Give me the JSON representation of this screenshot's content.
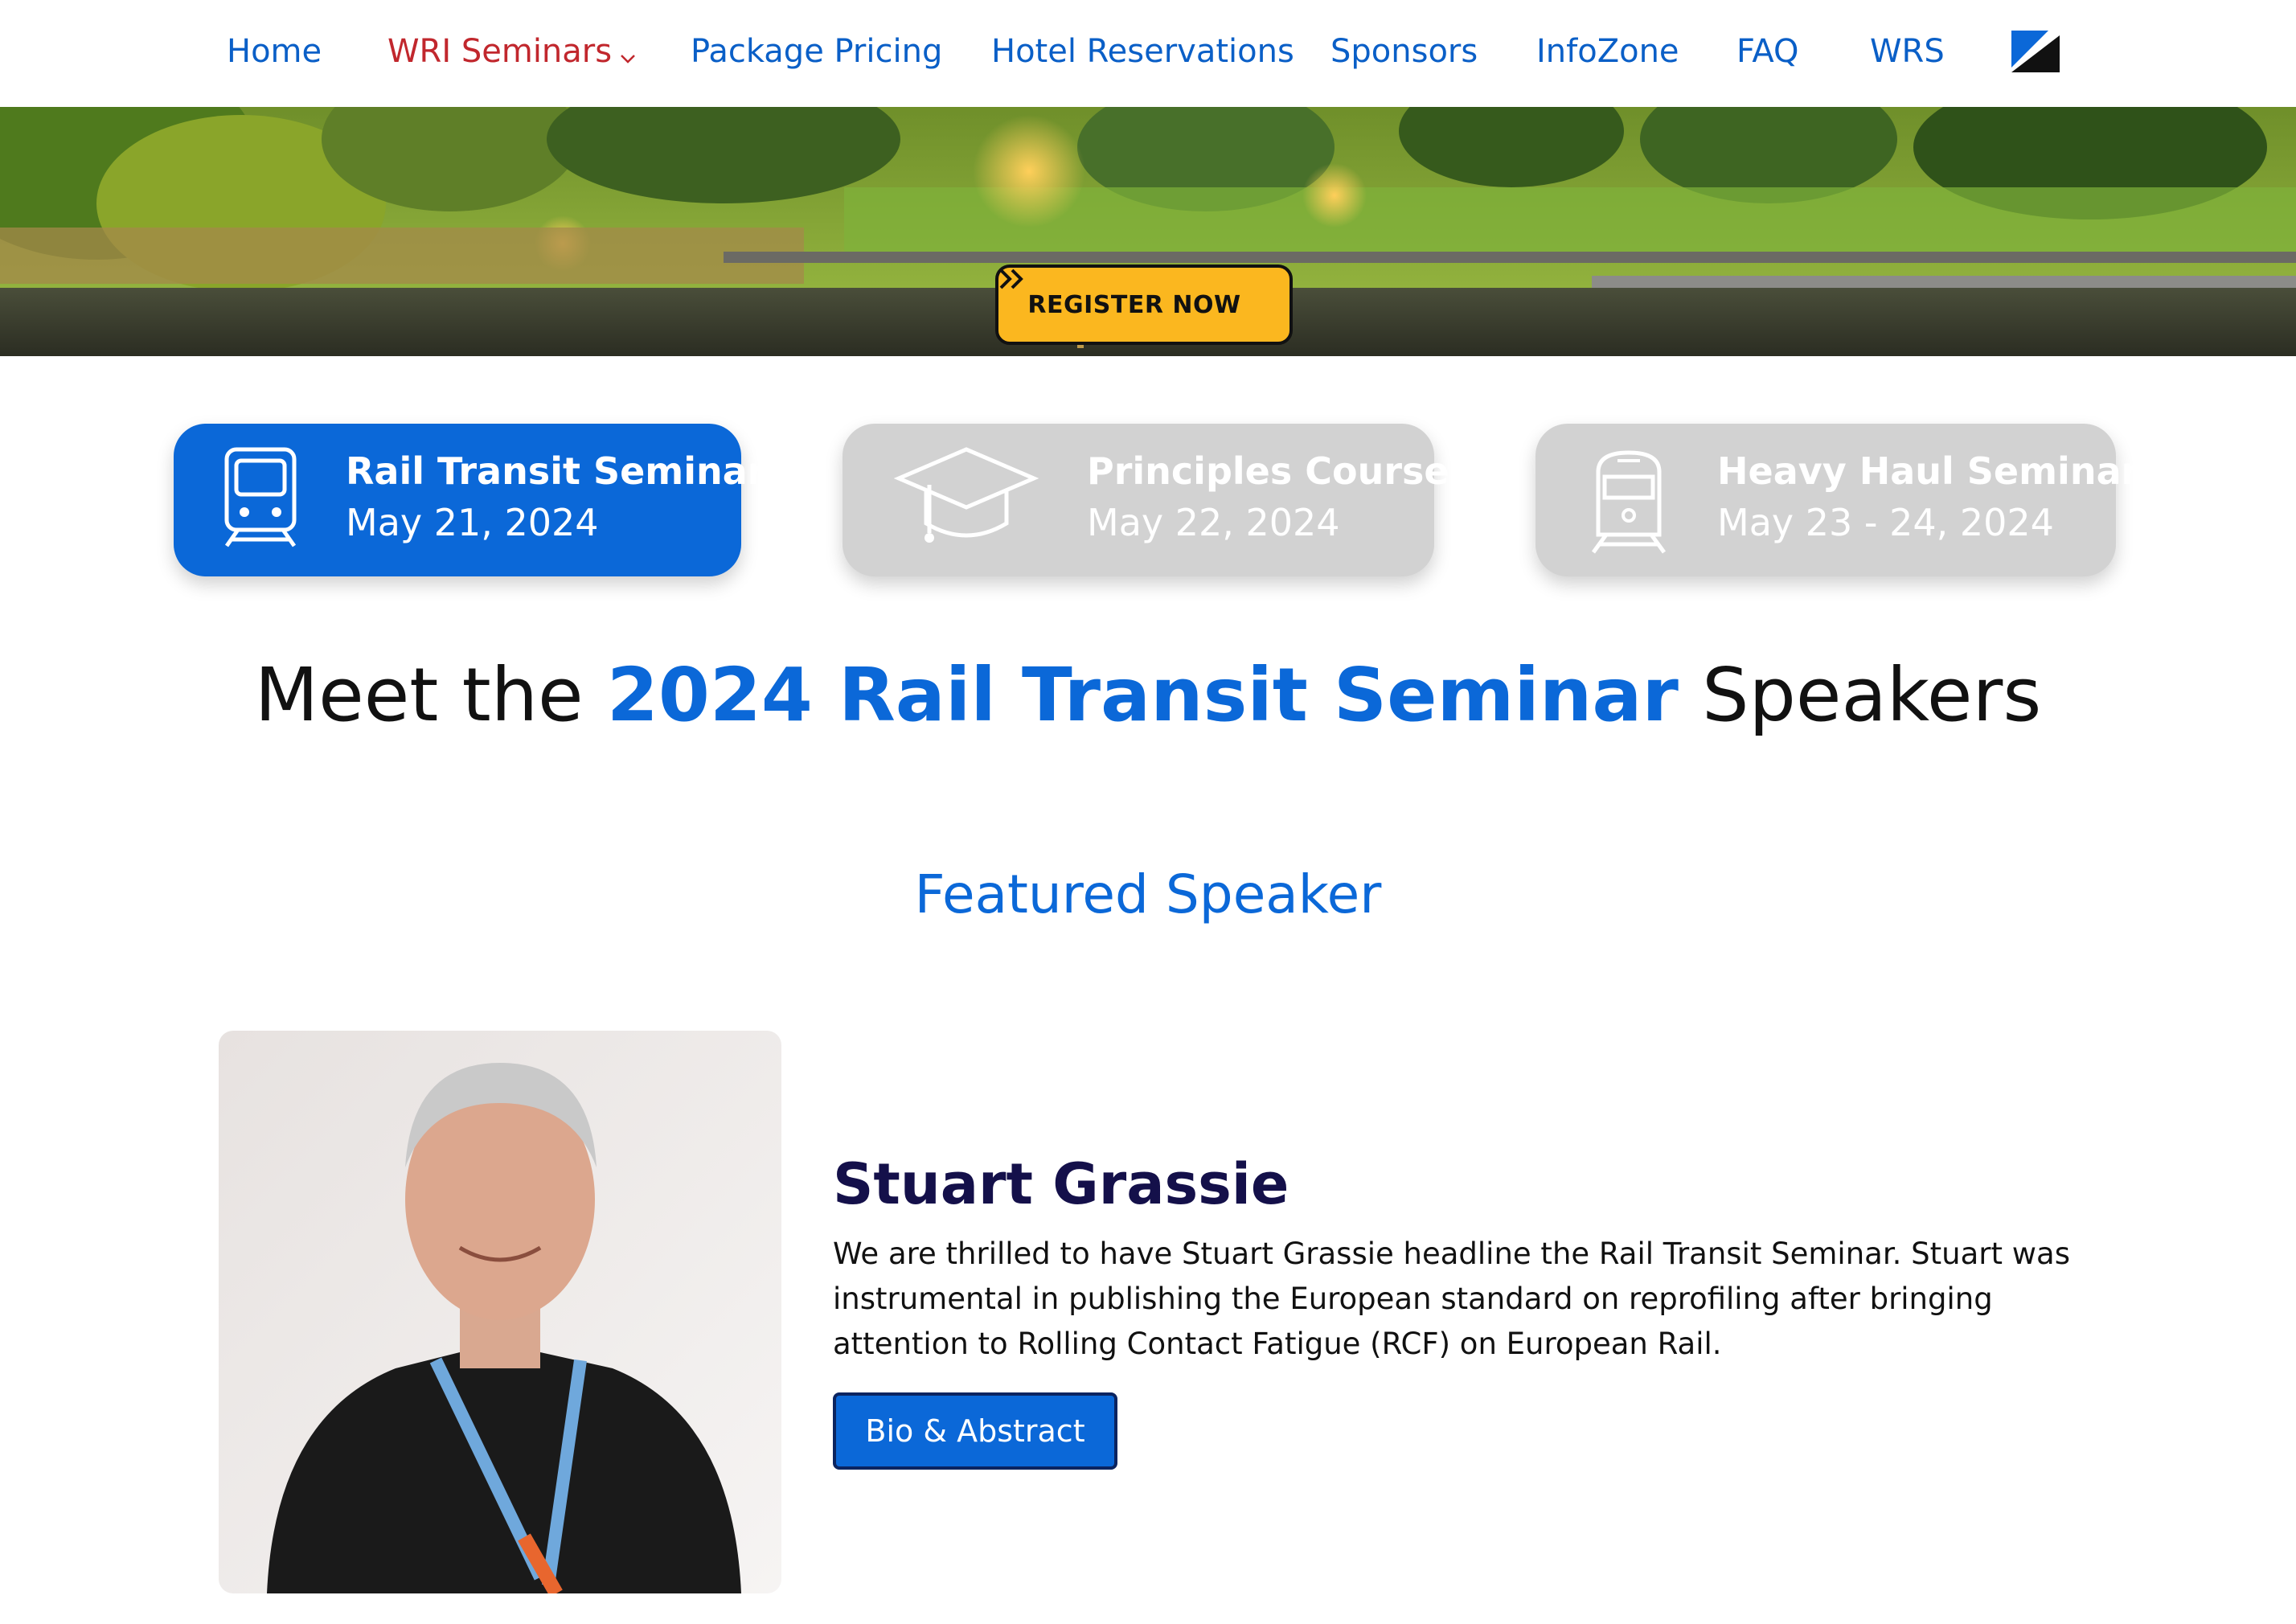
{
  "nav": {
    "items": [
      {
        "label": "Home",
        "active": false
      },
      {
        "label": "WRI Seminars",
        "active": true,
        "has_dropdown": true
      },
      {
        "label": "Package Pricing",
        "active": false
      },
      {
        "label": "Hotel Reservations",
        "active": false
      },
      {
        "label": "Sponsors",
        "active": false
      },
      {
        "label": "InfoZone",
        "active": false
      },
      {
        "label": "FAQ",
        "active": false
      },
      {
        "label": "WRS",
        "active": false
      }
    ],
    "logo_icon": "wri-logo-icon"
  },
  "hero": {
    "register_label": "REGISTER NOW",
    "register_icon": "double-chevron-right-icon"
  },
  "tabs": [
    {
      "title": "Rail Transit Seminar",
      "date": "May 21, 2024",
      "icon": "metro-train-icon",
      "active": true
    },
    {
      "title": "Principles Course",
      "date": "May 22, 2024",
      "icon": "graduation-cap-icon",
      "active": false
    },
    {
      "title": "Heavy Haul Seminar",
      "date": "May 23 - 24, 2024",
      "icon": "locomotive-icon",
      "active": false
    }
  ],
  "main": {
    "title_prefix": "Meet the",
    "title_accent": "2024 Rail Transit Seminar",
    "title_suffix": "Speakers",
    "section_title": "Featured Speaker"
  },
  "speaker": {
    "name": "Stuart Grassie",
    "bio": "We are thrilled to have Stuart Grassie headline the Rail Transit Seminar. Stuart was instrumental in publishing the European standard on reprofiling after bringing attention to Rolling Contact Fatigue (RCF) on European Rail.",
    "button_label": "Bio & Abstract"
  },
  "colors": {
    "brand_blue": "#0b68d8",
    "nav_active": "#c1272d",
    "register_yellow": "#fbb71f",
    "inactive_tab": "#d2d2d2",
    "speaker_name": "#14104a"
  }
}
